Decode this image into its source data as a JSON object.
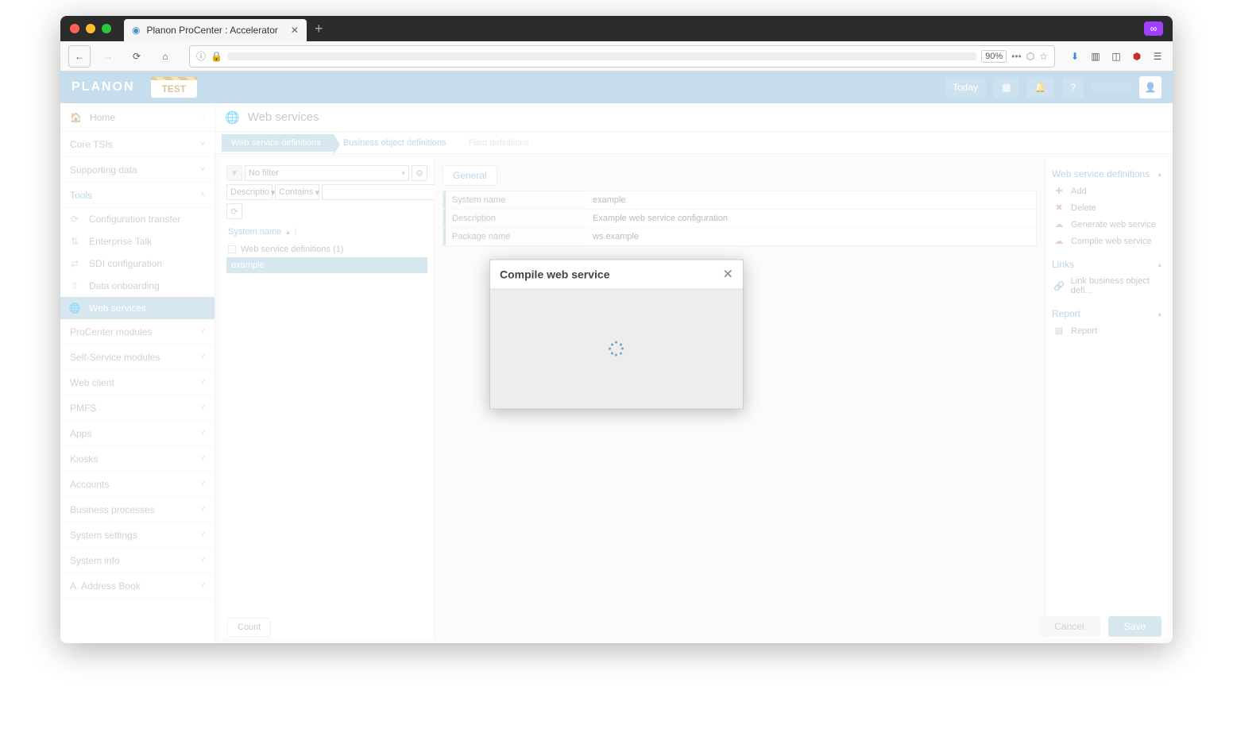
{
  "browser": {
    "tab_title": "Planon ProCenter : Accelerator",
    "zoom": "90%"
  },
  "header": {
    "logo": "PLANON",
    "logo_sub": "••••••",
    "badge": "TEST",
    "today": "Today"
  },
  "sidebar": {
    "home": "Home",
    "groups": [
      {
        "label": "Core TSIs",
        "expanded": false
      },
      {
        "label": "Supporting data",
        "expanded": false
      },
      {
        "label": "Tools",
        "expanded": true,
        "children": [
          {
            "label": "Configuration transfer",
            "icon": "refresh"
          },
          {
            "label": "Enterprise Talk",
            "icon": "updown"
          },
          {
            "label": "SDI configuration",
            "icon": "leftright"
          },
          {
            "label": "Data onboarding",
            "icon": "upload"
          },
          {
            "label": "Web services",
            "icon": "globe",
            "active": true
          }
        ]
      },
      {
        "label": "ProCenter modules",
        "expanded": false
      },
      {
        "label": "Self-Service modules",
        "expanded": false
      },
      {
        "label": "Web client",
        "expanded": false
      },
      {
        "label": "PMFS",
        "expanded": false
      },
      {
        "label": "Apps",
        "expanded": false
      },
      {
        "label": "Kiosks",
        "expanded": false
      },
      {
        "label": "Accounts",
        "expanded": false
      },
      {
        "label": "Business processes",
        "expanded": false
      },
      {
        "label": "System settings",
        "expanded": false
      },
      {
        "label": "System info",
        "expanded": false
      },
      {
        "label": "A. Address Book",
        "expanded": false
      }
    ]
  },
  "main": {
    "title": "Web services",
    "breadcrumbs": [
      {
        "label": "Web service definitions",
        "active": true
      },
      {
        "label": "Business object definitions"
      },
      {
        "label": "Field definitions",
        "disabled": true
      }
    ]
  },
  "list": {
    "filter_placeholder": "No filter",
    "filter_field": "Descriptio",
    "filter_op": "Contains",
    "sort_label": "System name",
    "group_label": "Web service definitions (1)",
    "rows": [
      "example"
    ],
    "count_btn": "Count"
  },
  "detail": {
    "tab": "General",
    "rows": [
      {
        "label": "System name",
        "value": "example"
      },
      {
        "label": "Description",
        "value": "Example web service configuration"
      },
      {
        "label": "Package name",
        "value": "ws.example"
      }
    ]
  },
  "actions": {
    "group1_title": "Web service definitions",
    "items1": [
      {
        "label": "Add",
        "icon": "plus",
        "cls": "green"
      },
      {
        "label": "Delete",
        "icon": "x",
        "cls": ""
      },
      {
        "label": "Generate web service",
        "icon": "gear",
        "cls": ""
      },
      {
        "label": "Compile web service",
        "icon": "gear",
        "cls": ""
      }
    ],
    "group2_title": "Links",
    "items2": [
      {
        "label": "Link business object defi...",
        "icon": "link",
        "cls": "blue"
      }
    ],
    "group3_title": "Report",
    "items3": [
      {
        "label": "Report",
        "icon": "doc",
        "cls": "blue"
      }
    ]
  },
  "footer": {
    "cancel": "Cancel",
    "save": "Save"
  },
  "modal": {
    "title": "Compile web service"
  }
}
